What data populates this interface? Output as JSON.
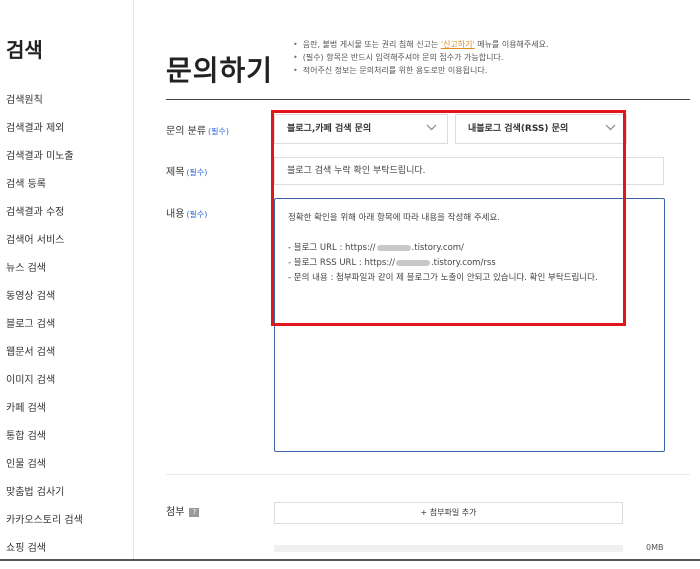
{
  "sidebar": {
    "title": "검색",
    "items": [
      {
        "label": "검색원칙"
      },
      {
        "label": "검색결과 제외"
      },
      {
        "label": "검색결과 미노출"
      },
      {
        "label": "검색 등록"
      },
      {
        "label": "검색결과 수정"
      },
      {
        "label": "검색어 서비스"
      },
      {
        "label": "뉴스 검색"
      },
      {
        "label": "동영상 검색"
      },
      {
        "label": "블로그 검색"
      },
      {
        "label": "웹문서 검색"
      },
      {
        "label": "이미지 검색"
      },
      {
        "label": "카페 검색"
      },
      {
        "label": "통합 검색"
      },
      {
        "label": "인물 검색"
      },
      {
        "label": "맞춤법 검사기"
      },
      {
        "label": "카카오스토리 검색"
      },
      {
        "label": "쇼핑 검색"
      }
    ]
  },
  "page": {
    "title": "문의하기",
    "notices": {
      "line1_before": "음란, 불법 게시물 또는 권리 침해 신고는 ",
      "line1_link": "'신고하기'",
      "line1_after": " 메뉴를 이용해주세요.",
      "line2": "(필수) 항목은 반드시 입력해주셔야 문의 접수가 가능합니다.",
      "line3": "적어주신 정보는 문의처리를 위한 용도로만 이용됩니다."
    }
  },
  "form": {
    "required_tag": "(필수)",
    "category": {
      "label": "문의 분류",
      "select1_value": "블로그,카페 검색 문의",
      "select2_value": "내블로그 검색(RSS) 문의"
    },
    "subject": {
      "label": "제목",
      "value": "블로그 검색 누락 확인 부탁드립니다."
    },
    "content": {
      "label": "내용",
      "line1": "정확한 확인을 위해 아래 항목에 따라 내용을 작성해 주세요.",
      "blog_url_prefix": "- 블로그 URL : https://",
      "blog_url_suffix": ".tistory.com/",
      "rss_url_prefix": "- 블로그 RSS URL : https://",
      "rss_url_suffix": ".tistory.com/rss",
      "inquiry": "- 문의 내용 : 첨부파일과 같이 제 블로그가 노출이 안되고 있습니다. 확인 부탁드립니다."
    },
    "attachment": {
      "label": "첨부",
      "help_icon_text": "?",
      "add_button": "+ 첨부파일 추가",
      "size": "0MB",
      "used_fraction": 0
    }
  },
  "colors": {
    "required_text": "#2d6bd8",
    "notice_link": "#e08b1b",
    "content_border": "#3a64a8",
    "annotation_box": "#e0161b"
  }
}
